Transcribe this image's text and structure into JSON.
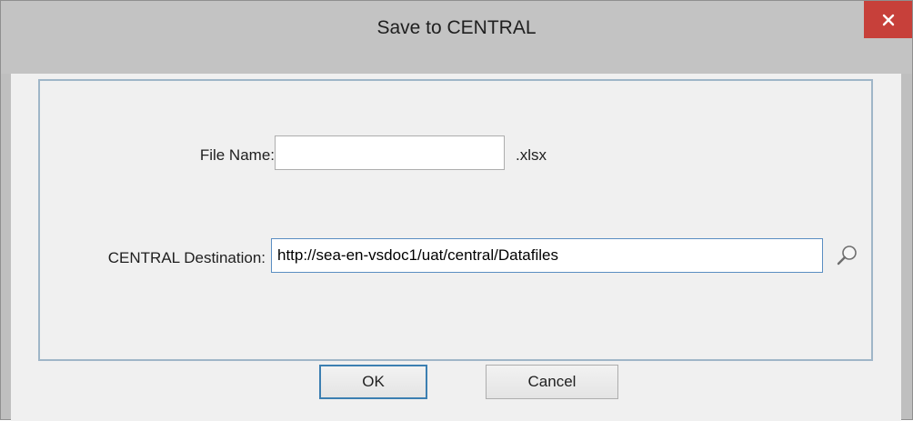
{
  "window": {
    "title": "Save to CENTRAL"
  },
  "form": {
    "file_name_label": "File Name:",
    "file_name_value": "",
    "file_extension": ".xlsx",
    "destination_label": "CENTRAL Destination:",
    "destination_value": "http://sea-en-vsdoc1/uat/central/Datafiles"
  },
  "buttons": {
    "ok_label": "OK",
    "cancel_label": "Cancel"
  },
  "icons": {
    "close": "close-icon",
    "browse": "magnifier-icon"
  },
  "colors": {
    "close_button": "#c7403a",
    "focus_border": "#5a8ec2",
    "default_button_border": "#3c7fb1",
    "panel_border": "#9fb6c8"
  }
}
